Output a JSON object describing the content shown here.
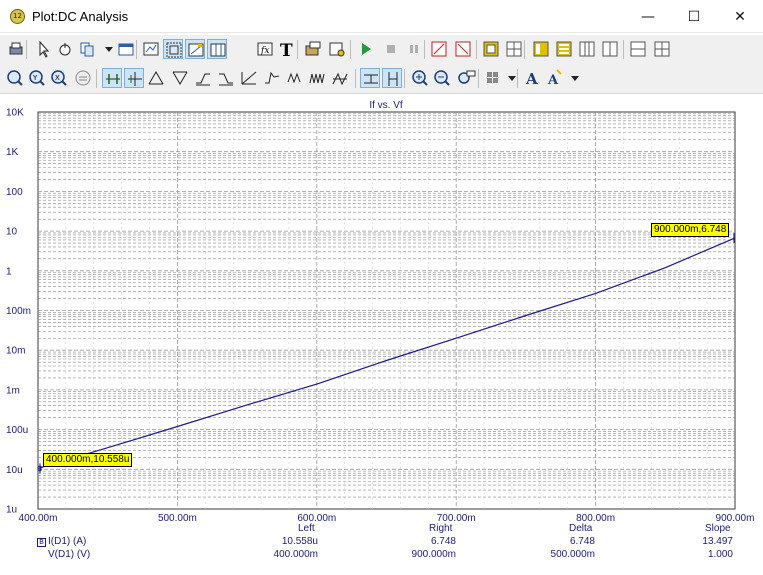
{
  "window": {
    "icon_text": "12",
    "title": "Plot:DC Analysis",
    "minimize_glyph": "—",
    "maximize_glyph": "☐",
    "close_glyph": "✕"
  },
  "toolbar1_icons": [
    "print-icon",
    "pointer-icon",
    "hand-pan-icon",
    "copy-icon",
    "dropdown-arrow-icon",
    "window-icon",
    "zoom-extents-icon",
    "zoom-window-icon",
    "marker-icon",
    "cursor-icon",
    "function-icon",
    "text-icon",
    "export-icon",
    "settings-icon",
    "run-icon",
    "stop-icon",
    "pause-icon",
    "zoom-in-plot-icon",
    "zoom-out-plot-icon",
    "frame-icon",
    "grid-small-icon",
    "layout-1-icon",
    "layout-2-icon",
    "layout-3-icon",
    "layout-4-icon",
    "split-h-icon",
    "split-grid-icon"
  ],
  "toolbar2_icons": [
    "zoom-fit-icon",
    "zoom-all-icon",
    "zoom-prev-icon",
    "zoom-reset-icon",
    "cursor-x-icon",
    "cursor-xy-icon",
    "peak-icon",
    "valley-icon",
    "rise-icon",
    "fall-icon",
    "slope-icon",
    "overshoot-icon",
    "period-icon",
    "pulse-icon",
    "ramp-icon",
    "horizontal-cursor-icon",
    "vertical-cursor-icon",
    "zoom-in-icon",
    "zoom-out-icon",
    "zoom-value-icon",
    "color-grid-icon",
    "dropdown-arrow-icon",
    "font-icon",
    "font-style-icon",
    "dropdown-arrow-icon"
  ],
  "chart_data": {
    "type": "line",
    "title": "If vs. Vf",
    "xlabel": "",
    "ylabel": "",
    "x_scale": "linear",
    "y_scale": "log",
    "xlim": [
      0.4,
      0.9
    ],
    "ylim": [
      1e-06,
      10000
    ],
    "x_ticks": [
      "400.00m",
      "500.00m",
      "600.00m",
      "700.00m",
      "800.00m",
      "900.00m"
    ],
    "y_ticks": [
      "1u",
      "10u",
      "100u",
      "1m",
      "10m",
      "100m",
      "1",
      "10",
      "100",
      "1K",
      "10K"
    ],
    "grid": true,
    "line_color": "#1a1a8c",
    "series": [
      {
        "name": "I(D1) (A)",
        "x": [
          0.4,
          0.45,
          0.5,
          0.55,
          0.6,
          0.65,
          0.7,
          0.75,
          0.8,
          0.85,
          0.9
        ],
        "y": [
          1.0558e-05,
          3.5e-05,
          0.00012,
          0.00042,
          0.0014,
          0.0055,
          0.02,
          0.075,
          0.27,
          1.2,
          6.748
        ]
      }
    ],
    "annotations": [
      "400.000m,10.558u",
      "900.000m,6.748"
    ]
  },
  "cursor_table": {
    "headers": [
      "Left",
      "Right",
      "Delta",
      "Slope"
    ],
    "legend_symbol": "B",
    "rows": [
      {
        "label": "I(D1) (A)",
        "values": [
          "10.558u",
          "6.748",
          "6.748",
          "13.497"
        ]
      },
      {
        "label": "V(D1) (V)",
        "values": [
          "400.000m",
          "900.000m",
          "500.000m",
          "1.000"
        ]
      }
    ]
  }
}
